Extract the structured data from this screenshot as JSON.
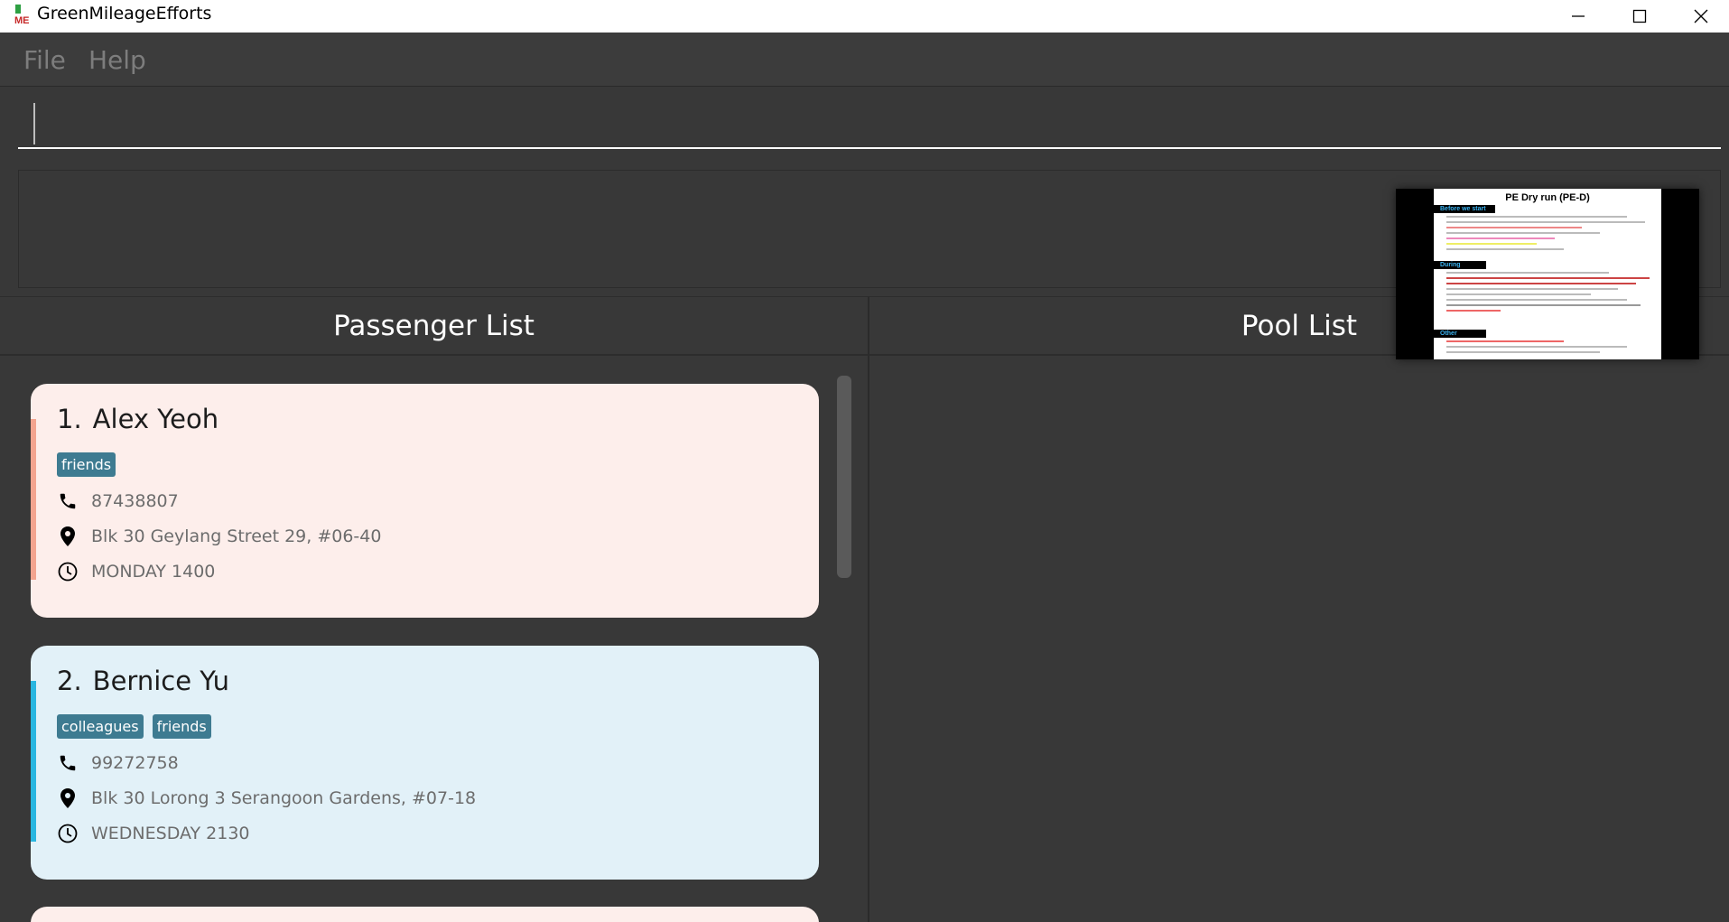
{
  "window": {
    "title": "GreenMileageEfforts"
  },
  "menu": {
    "file": "File",
    "help": "Help"
  },
  "command": {
    "value": "",
    "placeholder": ""
  },
  "result": {
    "text": ""
  },
  "panels": {
    "passenger_header": "Passenger List",
    "pool_header": "Pool List"
  },
  "passengers": [
    {
      "index": "1.",
      "name": "Alex Yeoh",
      "tags": [
        "friends"
      ],
      "phone": "87438807",
      "address": "Blk 30 Geylang Street 29, #06-40",
      "time": "MONDAY 1400",
      "card_color": "#fdeeeb",
      "bar_color": "#f3a48f"
    },
    {
      "index": "2.",
      "name": "Bernice Yu",
      "tags": [
        "colleagues",
        "friends"
      ],
      "phone": "99272758",
      "address": "Blk 30 Lorong 3 Serangoon Gardens, #07-18",
      "time": "WEDNESDAY 2130",
      "card_color": "#e2f1f8",
      "bar_color": "#29b6e0"
    }
  ],
  "preview": {
    "title": "PE Dry run (PE-D)",
    "sections": [
      "Before we start",
      "During",
      "Other"
    ]
  },
  "icons": {
    "phone": "phone-icon",
    "location": "location-pin-icon",
    "time": "clock-icon"
  }
}
